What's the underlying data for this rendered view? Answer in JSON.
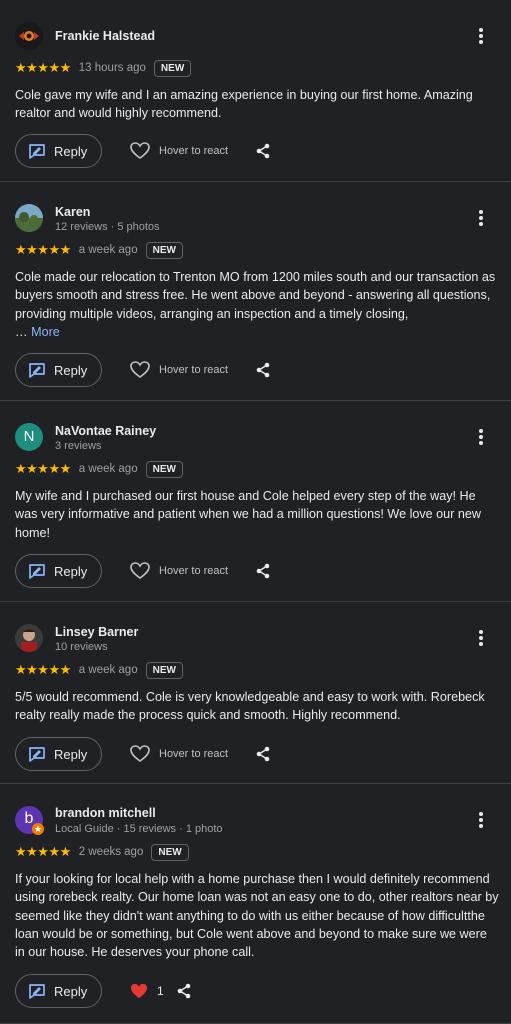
{
  "common": {
    "reply_label": "Reply",
    "react_label": "Hover to react",
    "new_badge": "NEW",
    "stars": "★★★★★",
    "more_label": "More"
  },
  "reviews": [
    {
      "name": "Frankie Halstead",
      "time": "13 hours ago",
      "text": "Cole gave my wife and I an amazing experience in buying our first home. Amazing realtor and would highly recommend.",
      "rating": 5
    },
    {
      "name": "Karen",
      "meta": "12 reviews · 5 photos",
      "time": "a week ago",
      "text": "Cole made our relocation to Trenton MO from 1200 miles south and our transaction as buyers smooth and stress free. He went above and beyond - answering all questions, providing multiple videos, arranging an inspection and a timely closing,",
      "ellipsis": "…",
      "rating": 5
    },
    {
      "name": "NaVontae Rainey",
      "meta": "3 reviews",
      "avatar_letter": "N",
      "avatar_color": "#1e8e7e",
      "time": "a week ago",
      "text": "My wife and I purchased our first house and Cole helped every step of the way! He was very informative and patient when we had a million questions! We love our new home!",
      "rating": 5
    },
    {
      "name": "Linsey Barner",
      "meta": "10 reviews",
      "time": "a week ago",
      "text": "5/5 would recommend. Cole is very knowledgeable and easy to work with. Rorebeck realty really made the process quick and smooth. Highly recommend.",
      "rating": 5
    },
    {
      "name": "brandon mitchell",
      "meta": "Local Guide · 15 reviews · 1 photo",
      "avatar_letter": "b",
      "avatar_color": "#5e35b1",
      "time": "2 weeks ago",
      "text": "If your looking for local help with a home purchase then I would definitely recommend using rorebeck realty. Our home loan was not an easy one to do, other realtors near by seemed like they didn't want anything to do with us either because of how difficultthe loan would be or something, but Cole went above and beyond to make sure we were in our house. He deserves your phone call.",
      "reaction_count": "1",
      "rating": 5
    }
  ],
  "colors": {
    "background": "#202124",
    "star": "#fbbc04",
    "link": "#8ab4f8",
    "reaction_heart": "#e53935"
  }
}
